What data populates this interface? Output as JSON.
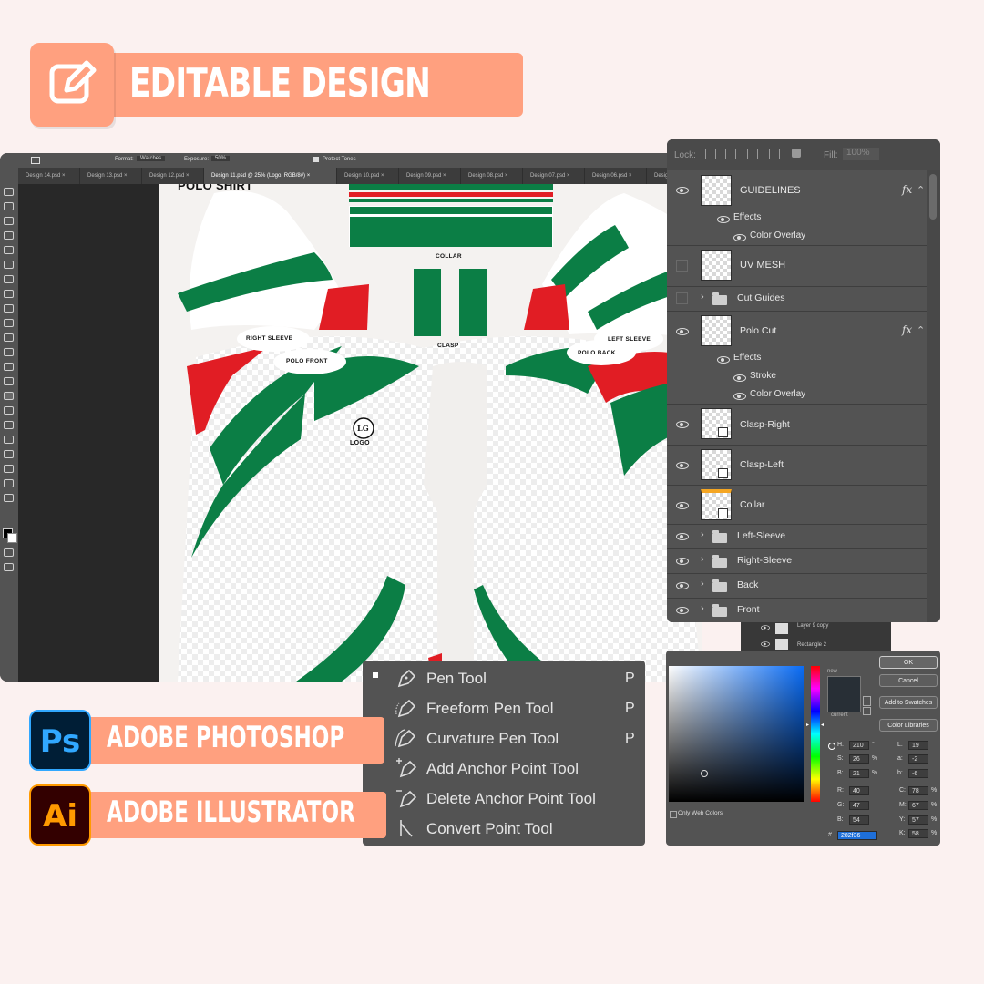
{
  "header": {
    "title": "EDITABLE DESIGN",
    "icon": "edit-icon"
  },
  "photoshop": {
    "options_bar": {
      "format_label": "Format:",
      "format_value": "Watches",
      "exposure_label": "Exposure:",
      "exposure_value": "50%",
      "protect_tones": "Protect Tones"
    },
    "tabs": [
      "Design 14.psd",
      "Design 13.psd",
      "Design 12.psd",
      "Design 11.psd @ 25% (Logo, RGB/8#)",
      "Design 10.psd",
      "Design 09.psd",
      "Design 08.psd",
      "Design 07.psd",
      "Design 06.psd",
      "Design 05.psd",
      "Design"
    ],
    "active_tab_index": 3,
    "canvas": {
      "title": "POLO SHIRT",
      "labels": {
        "collar": "COLLAR",
        "clasp": "CLASP",
        "right_sleeve": "RIGHT SLEEVE",
        "left_sleeve": "LEFT SLEEVE",
        "polo_front": "POLO FRONT",
        "polo_back": "POLO BACK",
        "logo": "LOGO",
        "logo_mark": "LG"
      },
      "colors": {
        "green": "#0b7e45",
        "red": "#e11d24",
        "white": "#ffffff"
      }
    }
  },
  "layers_panel": {
    "lock_label": "Lock:",
    "fill_label": "Fill:",
    "fill_value": "100%",
    "layers": [
      {
        "name": "GUIDELINES",
        "fx": "fx",
        "effects_label": "Effects",
        "effects": [
          "Color Overlay"
        ]
      },
      {
        "name": "UV MESH"
      },
      {
        "name": "Cut Guides",
        "type": "folder"
      },
      {
        "name": "Polo Cut",
        "fx": "fx",
        "effects_label": "Effects",
        "effects": [
          "Stroke",
          "Color Overlay"
        ]
      },
      {
        "name": "Clasp-Right"
      },
      {
        "name": "Clasp-Left"
      },
      {
        "name": "Collar"
      },
      {
        "name": "Left-Sleeve",
        "type": "folder"
      },
      {
        "name": "Right-Sleeve",
        "type": "folder"
      },
      {
        "name": "Back",
        "type": "folder"
      },
      {
        "name": "Front",
        "type": "folder"
      }
    ],
    "secondary_layers": [
      "Layer 9 copy",
      "Rectangle 2"
    ]
  },
  "pen_menu": {
    "items": [
      {
        "label": "Pen Tool",
        "shortcut": "P",
        "icon": "pen-icon"
      },
      {
        "label": "Freeform Pen Tool",
        "shortcut": "P",
        "icon": "freeform-pen-icon"
      },
      {
        "label": "Curvature Pen Tool",
        "shortcut": "P",
        "icon": "curvature-pen-icon"
      },
      {
        "label": "Add Anchor Point Tool",
        "shortcut": "",
        "icon": "add-anchor-icon"
      },
      {
        "label": "Delete Anchor Point Tool",
        "shortcut": "",
        "icon": "delete-anchor-icon"
      },
      {
        "label": "Convert Point Tool",
        "shortcut": "",
        "icon": "convert-point-icon"
      }
    ]
  },
  "color_picker": {
    "buttons": {
      "ok": "OK",
      "cancel": "Cancel",
      "add_swatches": "Add to Swatches",
      "color_libraries": "Color Libraries"
    },
    "new_label": "new",
    "current_label": "current",
    "only_web_colors": "Only Web Colors",
    "fields": {
      "H": "210",
      "S": "26",
      "B": "21",
      "R": "40",
      "G": "47",
      "Bl": "54",
      "L": "19",
      "a": "-2",
      "b": "-6",
      "C": "78",
      "M": "67",
      "Y": "57",
      "K": "58"
    },
    "units": {
      "H": "°",
      "S": "%",
      "B": "%",
      "C": "%",
      "M": "%",
      "Y": "%",
      "K": "%"
    },
    "hex": "282f36",
    "hex_label": "#",
    "current_color": "#282f36"
  },
  "apps": [
    {
      "name": "ADOBE PHOTOSHOP",
      "abbr": "Ps",
      "fg": "#31a8ff",
      "bg": "#001e36"
    },
    {
      "name": "ADOBE ILLUSTRATOR",
      "abbr": "Ai",
      "fg": "#ff9a00",
      "bg": "#330000"
    }
  ]
}
